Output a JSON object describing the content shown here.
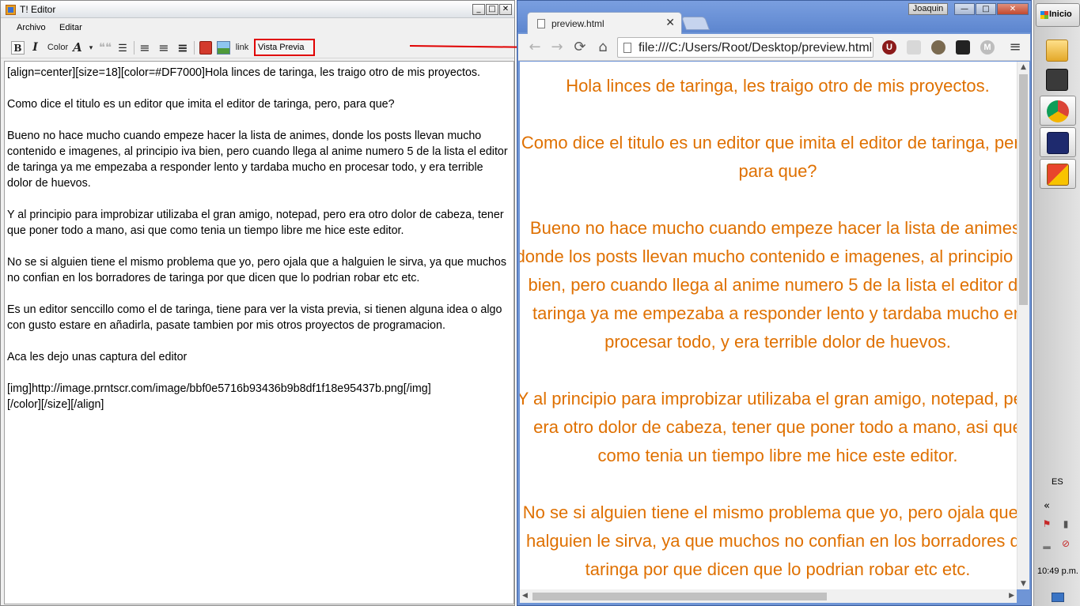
{
  "editor": {
    "title": "T! Editor",
    "window_buttons": {
      "minimize": "_",
      "maximize": "□",
      "close": "✕"
    },
    "menu": [
      "Archivo",
      "Editar"
    ],
    "toolbar": {
      "bold": "B",
      "italic": "I",
      "color": "Color",
      "font_size": "A",
      "font_dropdown_arrow": "▾",
      "quote": "❝❝",
      "list": "☰",
      "align_left": "≡",
      "align_right": "≡",
      "align_justify": "≡",
      "link": "link",
      "preview": "Vista Previa"
    },
    "content": [
      "[align=center][size=18][color=#DF7000]Hola lince​s de taringa, les traigo otro de mis proyectos.",
      "Como dice el titulo es un editor que imita el editor de taringa, pero, para que?",
      "Bueno no hace mucho cuando empeze hacer la lista de animes, donde los posts llevan mucho contenido e imagenes, al principio iva bien, pero cuando llega al anime numero 5 de la lista el editor de taringa ya me empezaba a responder lento y tardaba mucho en procesar todo, y era terrible dolor de huevos.",
      "Y al principio para improbizar utilizaba el gran amigo, notepad, pero era otro dolor de cabeza, tener que poner todo a mano, asi que como tenia un tiempo libre me hice este editor.",
      "No se si alguien tiene el mismo problema que yo, pero ojala que a halguien le sirva, ya que muchos no confian en los borradores de taringa por que dicen que lo podrian robar etc etc.",
      "Es un editor senccillo como el de taringa, tiene para ver la vista previa, si tienen alguna idea o algo con gusto estare en añadirla, pasate tambien por mis otros proyectos de programacion.",
      "Aca les dejo unas captura del editor",
      "[img]http://image.prntscr.com/image/bbf0e5716b93436b9b8df1f18e95437b.png[/img]",
      "[/color][/size][/align]"
    ]
  },
  "browser": {
    "tab_title": "preview.html",
    "tab_close": "✕",
    "user": "Joaquin",
    "window_buttons": {
      "minimize": "—",
      "maximize": "□",
      "close": "✕"
    },
    "nav": {
      "back": "←",
      "forward": "→",
      "reload": "⟳",
      "home": "⌂"
    },
    "address": "file:///C:/Users/Root/Desktop/preview.html",
    "extensions": [
      "U",
      "",
      "",
      "",
      "M"
    ],
    "menu": "≡",
    "text_color": "#DF7000",
    "preview_paragraphs": [
      "Hola linces de taringa, les traigo otro de mis proyectos.",
      "Como dice el titulo es un editor que imita el editor de taringa, pero, para que?",
      "Bueno no hace mucho cuando empeze hacer la lista de animes, donde los posts llevan mucho contenido e imagenes, al principio iva bien, pero cuando llega al anime numero 5 de la lista el editor de taringa ya me empezaba a responder lento y tardaba mucho en procesar todo, y era terrible dolor de huevos.",
      "Y al principio para improbizar utilizaba el gran amigo, notepad, pero era otro dolor de cabeza, tener que poner todo a mano, asi que como tenia un tiempo libre me hice este editor.",
      "No se si alguien tiene el mismo problema que yo, pero ojala que a halguien le sirva, ya que muchos no confian en los borradores de taringa por que dicen que lo podrian robar etc etc."
    ]
  },
  "taskbar": {
    "start_label": "Inicio",
    "language": "ES",
    "expand": "«",
    "clock": "10:49 p.m."
  }
}
